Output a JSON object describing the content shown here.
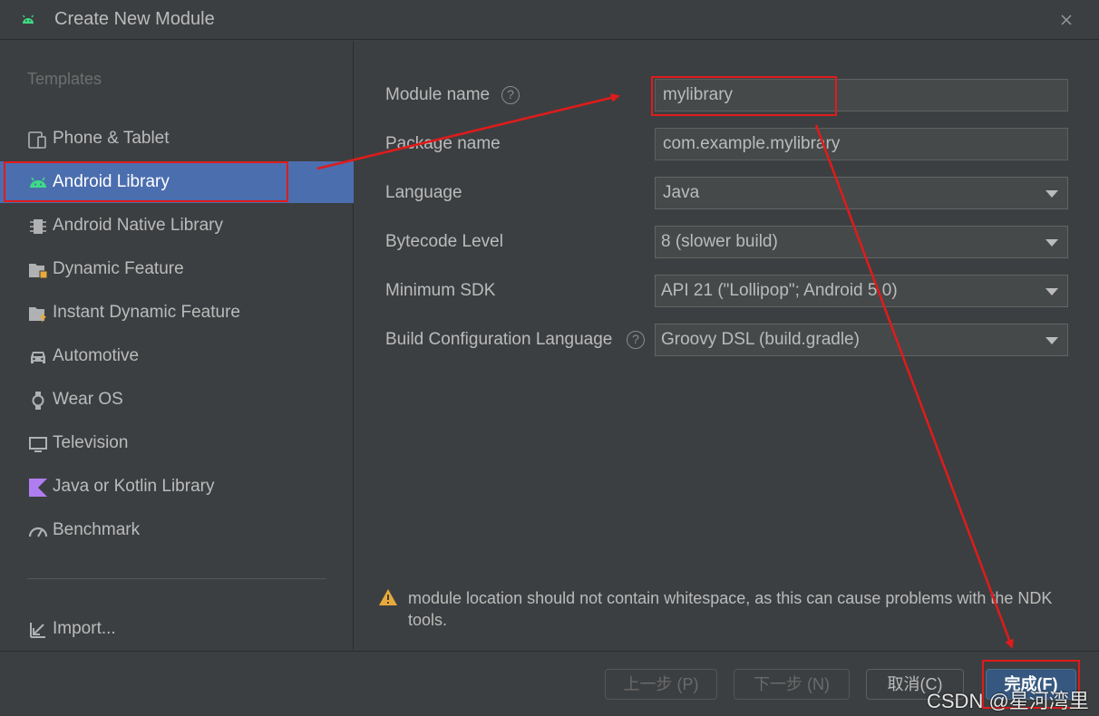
{
  "window": {
    "title": "Create New Module",
    "close_glyph": "✕"
  },
  "sidebar": {
    "header": "Templates",
    "items": [
      {
        "label": "Phone & Tablet",
        "icon": "phone-tablet-icon"
      },
      {
        "label": "Android Library",
        "icon": "android-icon",
        "selected": true
      },
      {
        "label": "Android Native Library",
        "icon": "chip-icon"
      },
      {
        "label": "Dynamic Feature",
        "icon": "folder-icon"
      },
      {
        "label": "Instant Dynamic Feature",
        "icon": "folder-bolt-icon"
      },
      {
        "label": "Automotive",
        "icon": "car-icon"
      },
      {
        "label": "Wear OS",
        "icon": "watch-icon"
      },
      {
        "label": "Television",
        "icon": "tv-icon"
      },
      {
        "label": "Java or Kotlin Library",
        "icon": "kotlin-icon"
      },
      {
        "label": "Benchmark",
        "icon": "gauge-icon"
      }
    ],
    "import_label": "Import..."
  },
  "form": {
    "module_name": {
      "label": "Module name",
      "value": "mylibrary"
    },
    "package_name": {
      "label": "Package name",
      "value": "com.example.mylibrary"
    },
    "language": {
      "label": "Language",
      "value": "Java"
    },
    "bytecode": {
      "label": "Bytecode Level",
      "value": "8 (slower build)"
    },
    "min_sdk": {
      "label": "Minimum SDK",
      "value": "API 21 (\"Lollipop\"; Android 5.0)"
    },
    "build_config": {
      "label": "Build Configuration Language",
      "value": "Groovy DSL (build.gradle)"
    },
    "help_glyph": "?"
  },
  "warning": {
    "text": "module location should not contain whitespace, as this can cause problems with the NDK tools."
  },
  "footer": {
    "previous": "上一步 (P)",
    "next": "下一步 (N)",
    "cancel": "取消(C)",
    "finish": "完成(F)"
  },
  "watermark": "CSDN @星河湾里",
  "colors": {
    "selection": "#4b6eaf",
    "annotation": "#e01b1b",
    "android_green": "#3ddc84",
    "warning": "#e8a93a"
  }
}
